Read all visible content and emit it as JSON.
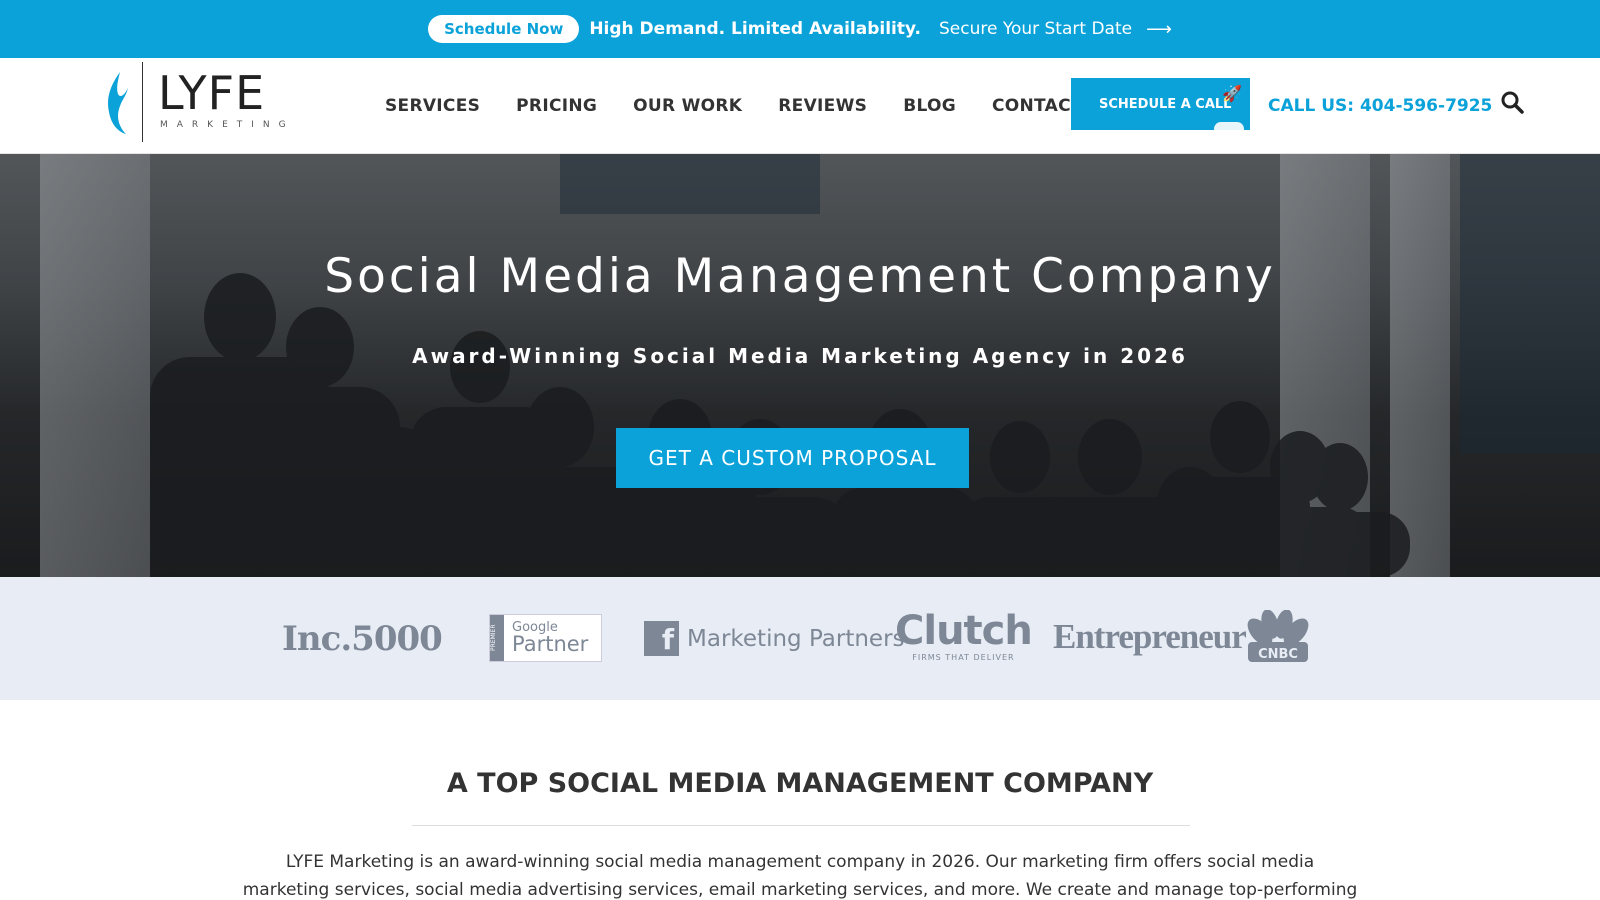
{
  "topbar": {
    "pill_label": "Schedule Now",
    "demand_text": "High Demand. Limited Availability.",
    "secure_text": "Secure Your Start Date",
    "arrow_icon": "long-arrow-right-icon"
  },
  "header": {
    "logo": {
      "word": "LYFE",
      "sub": "MARKETING"
    },
    "nav": [
      "SERVICES",
      "PRICING",
      "OUR WORK",
      "REVIEWS",
      "BLOG",
      "CONTACT"
    ],
    "cta_label": "SCHEDULE A CALL",
    "call_text": "CALL US: 404-596-7925",
    "search_icon": "search-icon"
  },
  "hero": {
    "title": "Social Media Management Company",
    "subtitle": "Award-Winning Social Media Marketing Agency in 2026",
    "button_label": "GET A CUSTOM PROPOSAL"
  },
  "logos": {
    "inc": "Inc.5000",
    "google_small": "Google",
    "google_big": "Partner",
    "google_premier": "PREMIER",
    "fb_label": "Marketing Partners",
    "fb_letter": "f",
    "clutch_main": "Clutch",
    "clutch_sub": "FIRMS THAT DELIVER",
    "entrepreneur": "Entrepreneur",
    "cnbc": "CNBC"
  },
  "section": {
    "title": "A TOP SOCIAL MEDIA MANAGEMENT COMPANY",
    "paragraph": "LYFE Marketing is an award-winning social media management company in 2026. Our marketing firm offers social media marketing services, social media advertising services, email marketing services, and more. We create and manage top-performing social media campaigns for"
  },
  "colors": {
    "accent": "#0aa2d9",
    "logo_gray": "#7d8796",
    "strip_bg": "#e8edf5"
  }
}
